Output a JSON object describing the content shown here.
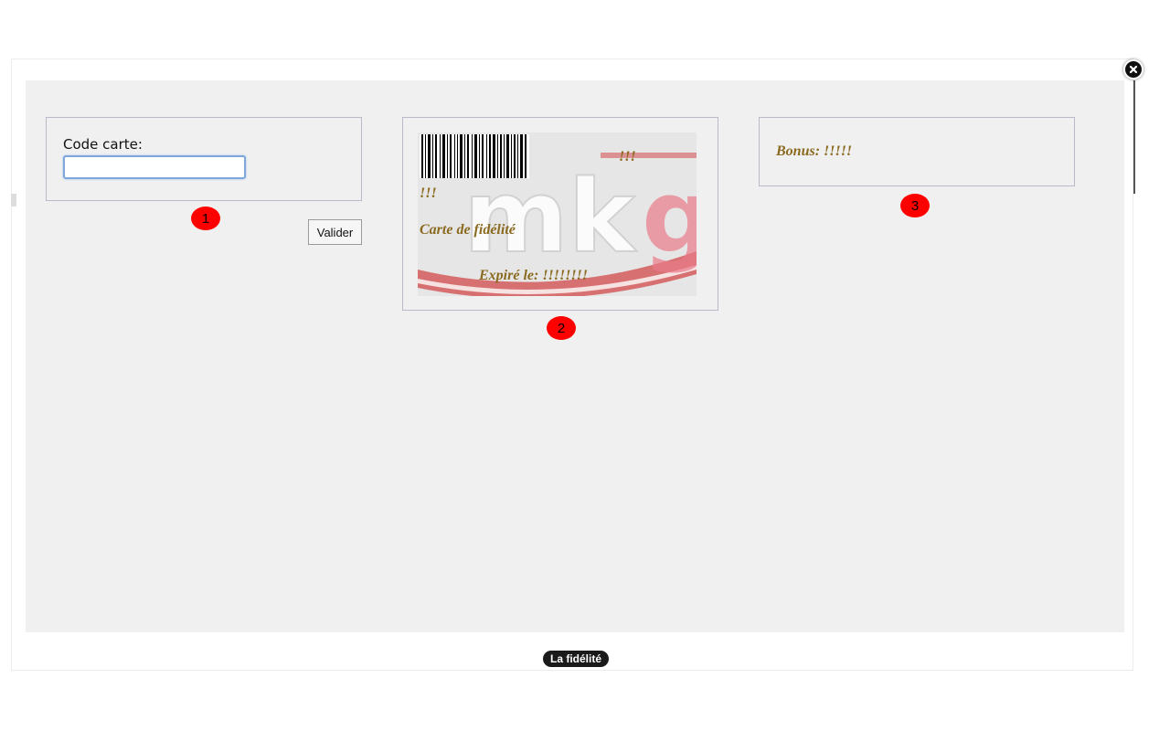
{
  "panel1": {
    "label": "Code carte:",
    "input_value": "",
    "input_placeholder": "",
    "button_label": "Valider"
  },
  "markers": [
    "1",
    "2",
    "3"
  ],
  "card": {
    "line1": "!!!",
    "line2": "!!!",
    "title": "Carte de fidélité",
    "expiry": "Expiré le: !!!!!!!!"
  },
  "bonus": {
    "text": "Bonus: !!!!!"
  },
  "caption": "La fidélité",
  "icons": {
    "close": "close-icon",
    "barcode": "barcode-icon",
    "logo": "mkg-logo"
  },
  "colors": {
    "card_text": "#8a6a1f",
    "marker": "#ff0000",
    "panel_bg": "#f0f0f0",
    "input_focus": "#7fa7d9"
  }
}
